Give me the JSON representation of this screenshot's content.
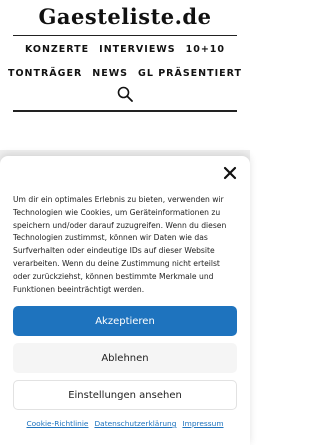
{
  "header": {
    "logo_text": "Gaesteliste.de",
    "nav_row1": [
      "KONZERTE",
      "INTERVIEWS",
      "10+10"
    ],
    "nav_row2": [
      "TONTRÄGER",
      "NEWS",
      "GL PRÄSENTIERT"
    ],
    "search_icon": "search-icon"
  },
  "consent": {
    "close_icon": "close-icon",
    "text": "Um dir ein optimales Erlebnis zu bieten, verwenden wir Technologien wie Cookies, um Geräteinformationen zu speichern und/oder darauf zuzugreifen. Wenn du diesen Technologien zustimmst, können wir Daten wie das Surfverhalten oder eindeutige IDs auf dieser Website verarbeiten. Wenn du deine Zustimmung nicht erteilst oder zurückziehst, können bestimmte Merkmale und Funktionen beeinträchtigt werden.",
    "accept_label": "Akzeptieren",
    "deny_label": "Ablehnen",
    "preferences_label": "Einstellungen ansehen",
    "links": [
      "Cookie-Richtlinie",
      "Datenschutzerklärung",
      "Impressum"
    ],
    "accent_color": "#1e73be"
  }
}
